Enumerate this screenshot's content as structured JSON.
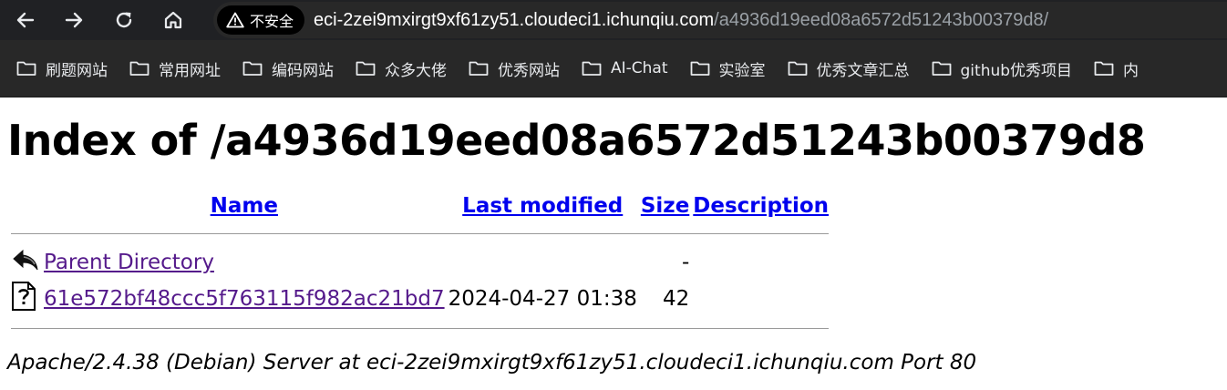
{
  "browser": {
    "security_label": "不安全",
    "url_host": "eci-2zei9mxirgt9xf61zy51.cloudeci1.ichunqiu.com",
    "url_path": "/a4936d19eed08a6572d51243b00379d8/",
    "bookmarks": [
      {
        "label": "刷题网站"
      },
      {
        "label": "常用网址"
      },
      {
        "label": "编码网站"
      },
      {
        "label": "众多大佬"
      },
      {
        "label": "优秀网站"
      },
      {
        "label": "AI-Chat"
      },
      {
        "label": "实验室"
      },
      {
        "label": "优秀文章汇总"
      },
      {
        "label": "github优秀项目"
      },
      {
        "label": "内"
      }
    ]
  },
  "page": {
    "title": "Index of /a4936d19eed08a6572d51243b00379d8",
    "columns": {
      "name": "Name",
      "last_modified": "Last modified",
      "size": "Size",
      "description": "Description"
    },
    "rows": [
      {
        "icon": "back-icon",
        "name": "Parent Directory",
        "modified": "",
        "size": "-",
        "description": ""
      },
      {
        "icon": "unknown-file-icon",
        "name": "61e572bf48ccc5f763115f982ac21bd7",
        "modified": "2024-04-27 01:38",
        "size": "42",
        "description": ""
      }
    ],
    "footer": "Apache/2.4.38 (Debian) Server at eci-2zei9mxirgt9xf61zy51.cloudeci1.ichunqiu.com Port 80"
  }
}
